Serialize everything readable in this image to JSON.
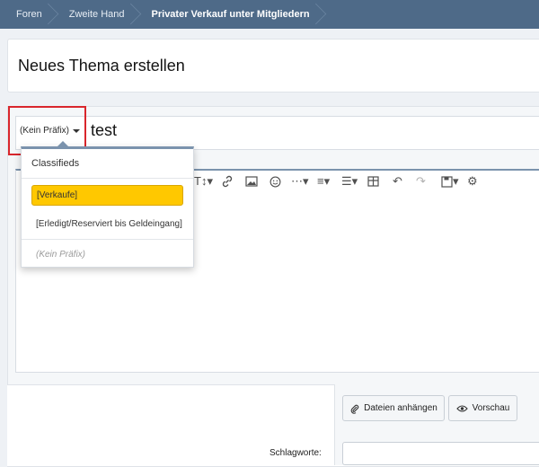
{
  "breadcrumb": [
    "Foren",
    "Zweite Hand",
    "Privater Verkauf unter Mitgliedern"
  ],
  "page_title": "Neues Thema erstellen",
  "prefix": {
    "label": "(Kein Präfix)"
  },
  "title_input": {
    "value": "test"
  },
  "prefix_dropdown": {
    "group": "Classifieds",
    "options": [
      "[Verkaufe]",
      "[Erledigt/Reserviert bis Geldeingang]",
      "(Kein Präfix)"
    ],
    "selected": "[Verkaufe]"
  },
  "actions": {
    "attach": "Dateien anhängen",
    "preview": "Vorschau"
  },
  "tags": {
    "label": "Schlagworte:"
  },
  "colors": {
    "header": "#4e6a88",
    "selected_option": "#ffc800",
    "highlight": "#d9262c"
  }
}
